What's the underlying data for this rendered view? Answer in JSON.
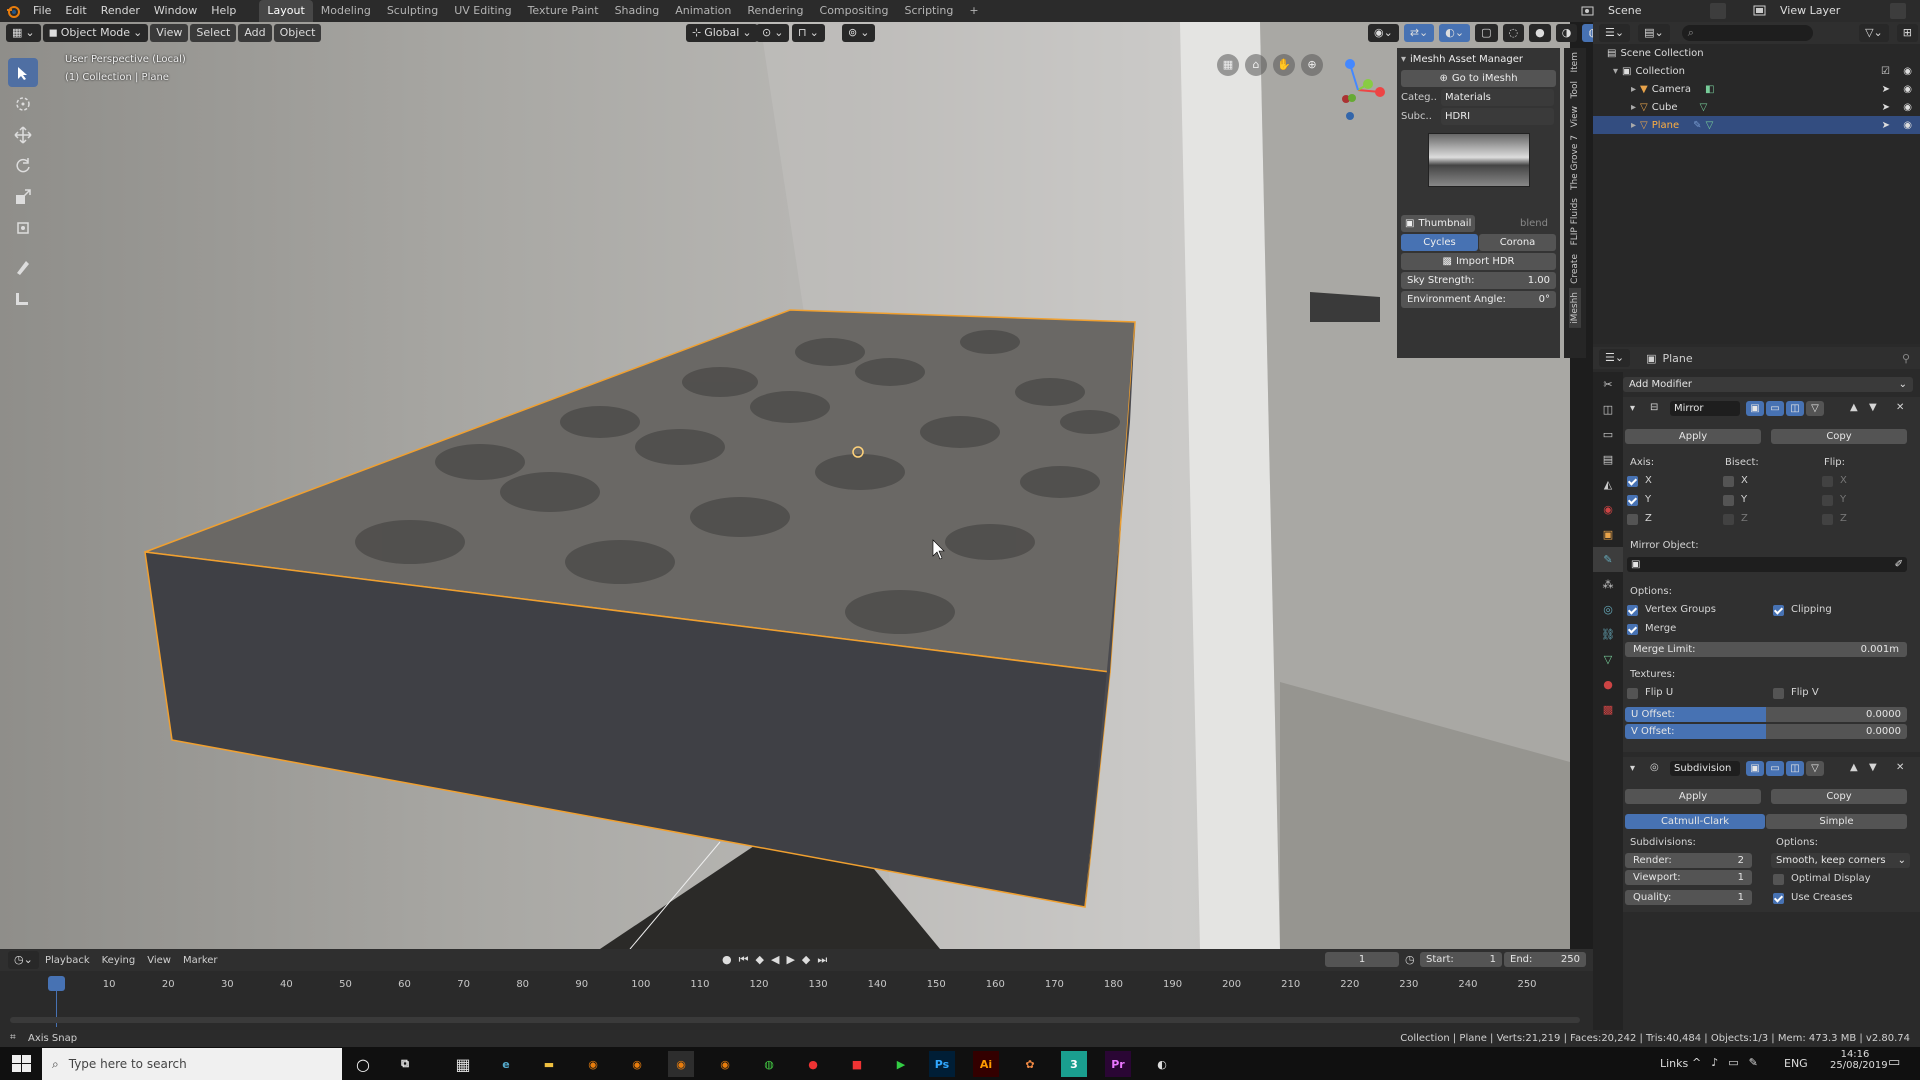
{
  "menu": {
    "items": [
      "File",
      "Edit",
      "Render",
      "Window",
      "Help"
    ],
    "workspaces": [
      "Layout",
      "Modeling",
      "Sculpting",
      "UV Editing",
      "Texture Paint",
      "Shading",
      "Animation",
      "Rendering",
      "Compositing",
      "Scripting"
    ],
    "add_workspace": "+",
    "scene_label": "Scene",
    "view_layer_label": "View Layer"
  },
  "viewport": {
    "mode": "Object Mode",
    "menus": [
      "View",
      "Select",
      "Add",
      "Object"
    ],
    "orientation": "Global",
    "perspective_label": "User Perspective (Local)",
    "collection_label": "(1) Collection | Plane"
  },
  "imeshh": {
    "title": "iMeshh Asset Manager",
    "go_button": "Go to iMeshh",
    "category_label": "Categ..",
    "category_value": "Materials",
    "subcategory_label": "Subc..",
    "subcategory_value": "HDRI",
    "thumbnail_label": "Thumbnail",
    "blend_label": "blend",
    "engine_cycles": "Cycles",
    "engine_corona": "Corona",
    "import_button": "Import HDR",
    "sky_strength_label": "Sky Strength:",
    "sky_strength_value": "1.00",
    "env_angle_label": "Environment Angle:",
    "env_angle_value": "0°",
    "side_tabs": [
      "Item",
      "Tool",
      "View",
      "The Grove 7",
      "FLIP Fluids",
      "Create",
      "iMeshh"
    ]
  },
  "outliner": {
    "root": "Scene Collection",
    "collection": "Collection",
    "objects": [
      "Camera",
      "Cube",
      "Plane"
    ]
  },
  "properties": {
    "object_name": "Plane",
    "add_modifier": "Add Modifier",
    "mirror": {
      "name": "Mirror",
      "apply": "Apply",
      "copy": "Copy",
      "axis_label": "Axis:",
      "bisect_label": "Bisect:",
      "flip_label": "Flip:",
      "x": "X",
      "y": "Y",
      "z": "Z",
      "mirror_object_label": "Mirror Object:",
      "options_label": "Options:",
      "vertex_groups": "Vertex Groups",
      "clipping": "Clipping",
      "merge": "Merge",
      "merge_limit_label": "Merge Limit:",
      "merge_limit_value": "0.001m",
      "textures_label": "Textures:",
      "flip_u": "Flip U",
      "flip_v": "Flip V",
      "u_offset_label": "U Offset:",
      "u_offset_value": "0.0000",
      "v_offset_label": "V Offset:",
      "v_offset_value": "0.0000"
    },
    "subdivision": {
      "name": "Subdivision",
      "apply": "Apply",
      "copy": "Copy",
      "catmull": "Catmull-Clark",
      "simple": "Simple",
      "subdivisions_label": "Subdivisions:",
      "options_label": "Options:",
      "render_label": "Render:",
      "render_value": "2",
      "viewport_label": "Viewport:",
      "viewport_value": "1",
      "quality_label": "Quality:",
      "quality_value": "1",
      "uv_smooth": "Smooth, keep corners",
      "optimal_display": "Optimal Display",
      "use_creases": "Use Creases"
    }
  },
  "timeline": {
    "menus": [
      "Playback",
      "Keying",
      "View",
      "Marker"
    ],
    "current_frame": "1",
    "start_label": "Start:",
    "start_value": "1",
    "end_label": "End:",
    "end_value": "250",
    "ticks": [
      "1",
      "10",
      "20",
      "30",
      "40",
      "50",
      "60",
      "70",
      "80",
      "90",
      "100",
      "110",
      "120",
      "130",
      "140",
      "150",
      "160",
      "170",
      "180",
      "190",
      "200",
      "210",
      "220",
      "230",
      "240",
      "250"
    ]
  },
  "status": {
    "left": "Axis Snap",
    "right": "Collection | Plane | Verts:21,219 | Faces:20,242 | Tris:40,484 | Objects:1/3 | Mem: 473.3 MB | v2.80.74"
  },
  "taskbar": {
    "search_placeholder": "Type here to search",
    "links": "Links",
    "lang": "ENG",
    "time": "14:16",
    "date": "25/08/2019",
    "app_labels": [
      "Ps",
      "Ai",
      "3",
      "Pr"
    ]
  },
  "colors": {
    "accent": "#4772b3",
    "selection_outline": "#f0a030",
    "background": "#2b2b2b"
  }
}
